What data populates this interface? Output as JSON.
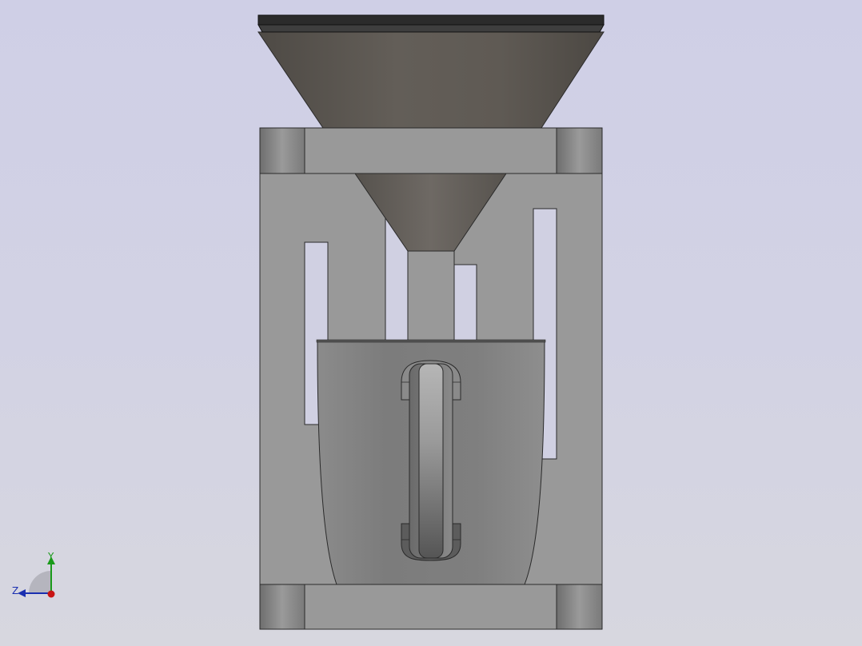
{
  "viewport": {
    "background_top": "#cfcfe6",
    "background_bottom": "#d7d7df"
  },
  "triad": {
    "y_label": "Y",
    "z_label": "Z",
    "y_color": "#1a9a1a",
    "z_color": "#1a2fb0",
    "x_color": "#c81414"
  },
  "model": {
    "name": "coffee-machine-assembly",
    "parts": [
      "hopper-lid",
      "hopper",
      "funnel",
      "frame",
      "mug",
      "mug-handle"
    ]
  }
}
